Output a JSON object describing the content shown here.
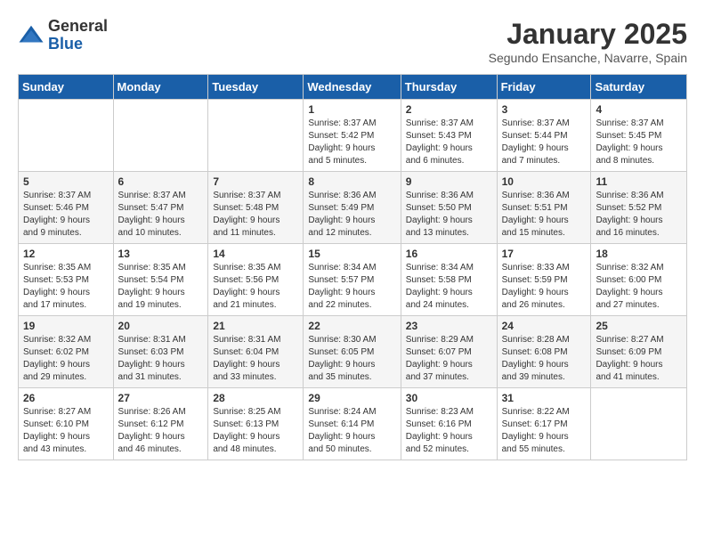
{
  "logo": {
    "general": "General",
    "blue": "Blue"
  },
  "title": "January 2025",
  "subtitle": "Segundo Ensanche, Navarre, Spain",
  "days_of_week": [
    "Sunday",
    "Monday",
    "Tuesday",
    "Wednesday",
    "Thursday",
    "Friday",
    "Saturday"
  ],
  "weeks": [
    [
      {
        "day": "",
        "info": ""
      },
      {
        "day": "",
        "info": ""
      },
      {
        "day": "",
        "info": ""
      },
      {
        "day": "1",
        "info": "Sunrise: 8:37 AM\nSunset: 5:42 PM\nDaylight: 9 hours\nand 5 minutes."
      },
      {
        "day": "2",
        "info": "Sunrise: 8:37 AM\nSunset: 5:43 PM\nDaylight: 9 hours\nand 6 minutes."
      },
      {
        "day": "3",
        "info": "Sunrise: 8:37 AM\nSunset: 5:44 PM\nDaylight: 9 hours\nand 7 minutes."
      },
      {
        "day": "4",
        "info": "Sunrise: 8:37 AM\nSunset: 5:45 PM\nDaylight: 9 hours\nand 8 minutes."
      }
    ],
    [
      {
        "day": "5",
        "info": "Sunrise: 8:37 AM\nSunset: 5:46 PM\nDaylight: 9 hours\nand 9 minutes."
      },
      {
        "day": "6",
        "info": "Sunrise: 8:37 AM\nSunset: 5:47 PM\nDaylight: 9 hours\nand 10 minutes."
      },
      {
        "day": "7",
        "info": "Sunrise: 8:37 AM\nSunset: 5:48 PM\nDaylight: 9 hours\nand 11 minutes."
      },
      {
        "day": "8",
        "info": "Sunrise: 8:36 AM\nSunset: 5:49 PM\nDaylight: 9 hours\nand 12 minutes."
      },
      {
        "day": "9",
        "info": "Sunrise: 8:36 AM\nSunset: 5:50 PM\nDaylight: 9 hours\nand 13 minutes."
      },
      {
        "day": "10",
        "info": "Sunrise: 8:36 AM\nSunset: 5:51 PM\nDaylight: 9 hours\nand 15 minutes."
      },
      {
        "day": "11",
        "info": "Sunrise: 8:36 AM\nSunset: 5:52 PM\nDaylight: 9 hours\nand 16 minutes."
      }
    ],
    [
      {
        "day": "12",
        "info": "Sunrise: 8:35 AM\nSunset: 5:53 PM\nDaylight: 9 hours\nand 17 minutes."
      },
      {
        "day": "13",
        "info": "Sunrise: 8:35 AM\nSunset: 5:54 PM\nDaylight: 9 hours\nand 19 minutes."
      },
      {
        "day": "14",
        "info": "Sunrise: 8:35 AM\nSunset: 5:56 PM\nDaylight: 9 hours\nand 21 minutes."
      },
      {
        "day": "15",
        "info": "Sunrise: 8:34 AM\nSunset: 5:57 PM\nDaylight: 9 hours\nand 22 minutes."
      },
      {
        "day": "16",
        "info": "Sunrise: 8:34 AM\nSunset: 5:58 PM\nDaylight: 9 hours\nand 24 minutes."
      },
      {
        "day": "17",
        "info": "Sunrise: 8:33 AM\nSunset: 5:59 PM\nDaylight: 9 hours\nand 26 minutes."
      },
      {
        "day": "18",
        "info": "Sunrise: 8:32 AM\nSunset: 6:00 PM\nDaylight: 9 hours\nand 27 minutes."
      }
    ],
    [
      {
        "day": "19",
        "info": "Sunrise: 8:32 AM\nSunset: 6:02 PM\nDaylight: 9 hours\nand 29 minutes."
      },
      {
        "day": "20",
        "info": "Sunrise: 8:31 AM\nSunset: 6:03 PM\nDaylight: 9 hours\nand 31 minutes."
      },
      {
        "day": "21",
        "info": "Sunrise: 8:31 AM\nSunset: 6:04 PM\nDaylight: 9 hours\nand 33 minutes."
      },
      {
        "day": "22",
        "info": "Sunrise: 8:30 AM\nSunset: 6:05 PM\nDaylight: 9 hours\nand 35 minutes."
      },
      {
        "day": "23",
        "info": "Sunrise: 8:29 AM\nSunset: 6:07 PM\nDaylight: 9 hours\nand 37 minutes."
      },
      {
        "day": "24",
        "info": "Sunrise: 8:28 AM\nSunset: 6:08 PM\nDaylight: 9 hours\nand 39 minutes."
      },
      {
        "day": "25",
        "info": "Sunrise: 8:27 AM\nSunset: 6:09 PM\nDaylight: 9 hours\nand 41 minutes."
      }
    ],
    [
      {
        "day": "26",
        "info": "Sunrise: 8:27 AM\nSunset: 6:10 PM\nDaylight: 9 hours\nand 43 minutes."
      },
      {
        "day": "27",
        "info": "Sunrise: 8:26 AM\nSunset: 6:12 PM\nDaylight: 9 hours\nand 46 minutes."
      },
      {
        "day": "28",
        "info": "Sunrise: 8:25 AM\nSunset: 6:13 PM\nDaylight: 9 hours\nand 48 minutes."
      },
      {
        "day": "29",
        "info": "Sunrise: 8:24 AM\nSunset: 6:14 PM\nDaylight: 9 hours\nand 50 minutes."
      },
      {
        "day": "30",
        "info": "Sunrise: 8:23 AM\nSunset: 6:16 PM\nDaylight: 9 hours\nand 52 minutes."
      },
      {
        "day": "31",
        "info": "Sunrise: 8:22 AM\nSunset: 6:17 PM\nDaylight: 9 hours\nand 55 minutes."
      },
      {
        "day": "",
        "info": ""
      }
    ]
  ]
}
